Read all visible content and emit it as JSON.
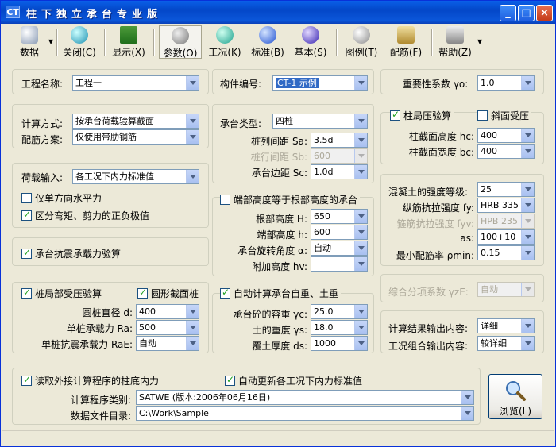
{
  "window": {
    "icon_label": "CT",
    "title": "柱下独立承台专业版",
    "buttons": {
      "minimize": "_",
      "maximize": "□",
      "close": "×"
    },
    "colors": {
      "titlebar": "#0347C8",
      "close": "#C43B1A"
    }
  },
  "toolbar": {
    "items": [
      {
        "label": "数据",
        "icon": "database-icon"
      },
      {
        "label": "关闭(C)",
        "icon": "close-icon"
      },
      {
        "label": "显示(X)",
        "icon": "display-icon"
      },
      {
        "label": "参数(O)",
        "icon": "parameters-icon"
      },
      {
        "label": "工况(K)",
        "icon": "load-case-icon"
      },
      {
        "label": "标准(B)",
        "icon": "standard-icon"
      },
      {
        "label": "基本(S)",
        "icon": "basic-icon"
      },
      {
        "label": "图例(T)",
        "icon": "legend-icon"
      },
      {
        "label": "配筋(F)",
        "icon": "reinforcement-icon"
      },
      {
        "label": "帮助(Z)",
        "icon": "help-icon"
      }
    ]
  },
  "project": {
    "name_label": "工程名称:",
    "name_value": "工程一",
    "member_label": "构件编号:",
    "member_value": "CT-1 示例"
  },
  "importance": {
    "label": "重要性系数 γo:",
    "value": "1.0"
  },
  "calc": {
    "method_label": "计算方式:",
    "method_value": "按承台荷载验算截面",
    "scheme_label": "配筋方案:",
    "scheme_value": "仅使用带肋钢筋"
  },
  "load": {
    "input_label": "荷载输入:",
    "input_value": "各工况下内力标准值",
    "only_unidirectional": "仅单方向水平力",
    "distinguish_signs": "区分弯矩、剪力的正负极值"
  },
  "seismic": {
    "label": "承台抗震承载力验算"
  },
  "cap": {
    "type_label": "承台类型:",
    "type_value": "四桩",
    "pile_row_label": "桩列间距 Sa:",
    "pile_row_value": "3.5d",
    "pile_line_label": "桩行间距 Sb:",
    "pile_line_value": "600",
    "edge_label": "承台边距 Sc:",
    "edge_value": "1.0d"
  },
  "end_height": {
    "check_label": "端部高度等于根部高度的承台",
    "root_label": "根部高度 H:",
    "root_value": "650",
    "end_label": "端部高度 h:",
    "end_value": "600",
    "rot_label": "承台旋转角度 α:",
    "rot_value": "自动",
    "add_label": "附加高度 hv:",
    "add_value": ""
  },
  "column": {
    "local_label": "柱局压验算",
    "slope_label": "斜面受压",
    "hc_label": "柱截面高度 hc:",
    "hc_value": "400",
    "bc_label": "柱截面宽度 bc:",
    "bc_value": "400"
  },
  "materials": {
    "concrete_label": "混凝土的强度等级:",
    "concrete_value": "25",
    "fy_label": "纵筋抗拉强度 fy:",
    "fy_value": "HRB 335",
    "fyv_label": "箍筋抗拉强度 fyv:",
    "fyv_value": "HPB 235",
    "as_label": "as:",
    "as_value": "100+10",
    "pmin_label": "最小配筋率 ρmin:",
    "pmin_value": "0.15"
  },
  "pile_local": {
    "check_label": "桩局部受压验算",
    "round_label": "圆形截面桩",
    "d_label": "圆桩直径 d:",
    "d_value": "400",
    "ra_label": "单桩承载力 Ra:",
    "ra_value": "500",
    "rae_label": "单桩抗震承载力 RaE:",
    "rae_value": "自动"
  },
  "selfweight": {
    "check_label": "自动计算承台自重、土重",
    "yc_label": "承台砼的容重 γc:",
    "yc_value": "25.0",
    "ys_label": "土的重度 γs:",
    "ys_value": "18.0",
    "ds_label": "覆土厚度 ds:",
    "ds_value": "1000"
  },
  "combo_factor": {
    "label": "综合分项系数 γzE:",
    "value": "自动"
  },
  "output": {
    "result_label": "计算结果输出内容:",
    "result_value": "详细",
    "case_label": "工况组合输出内容:",
    "case_value": "较详细"
  },
  "external": {
    "read_label": "读取外接计算程序的柱底内力",
    "auto_label": "自动更新各工况下内力标准值",
    "program_label": "计算程序类别:",
    "program_value": "SATWE (版本:2006年06月16日)",
    "dir_label": "数据文件目录:",
    "dir_value": "C:\\Work\\Sample"
  },
  "browse": {
    "label": "浏览(L)"
  }
}
